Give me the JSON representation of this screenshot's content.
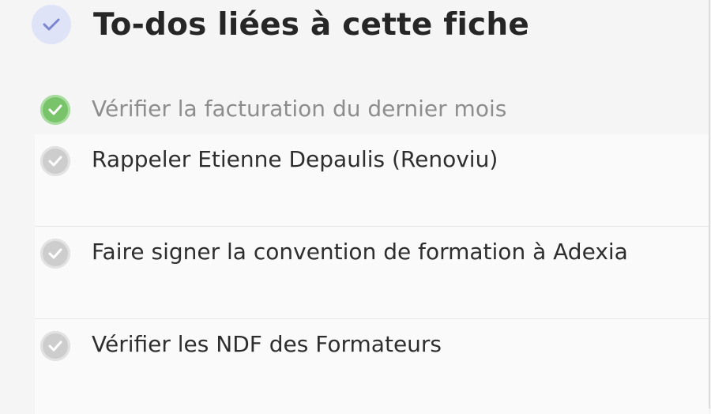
{
  "header": {
    "title": "To-dos liées à cette fiche",
    "icon": "check-icon",
    "icon_bg_color": "#dfe3f7",
    "icon_color": "#7c86d0"
  },
  "todos": [
    {
      "label": "Vérifier la facturation du dernier mois",
      "completed": true,
      "status_color": "#79c36a"
    },
    {
      "label": "Rappeler Etienne Depaulis (Renoviu)",
      "completed": false,
      "status_color": "#cdcdcd"
    },
    {
      "label": "Faire signer la convention de formation à Adexia",
      "completed": false,
      "status_color": "#cdcdcd"
    },
    {
      "label": "Vérifier les NDF des Formateurs",
      "completed": false,
      "status_color": "#cdcdcd"
    }
  ]
}
